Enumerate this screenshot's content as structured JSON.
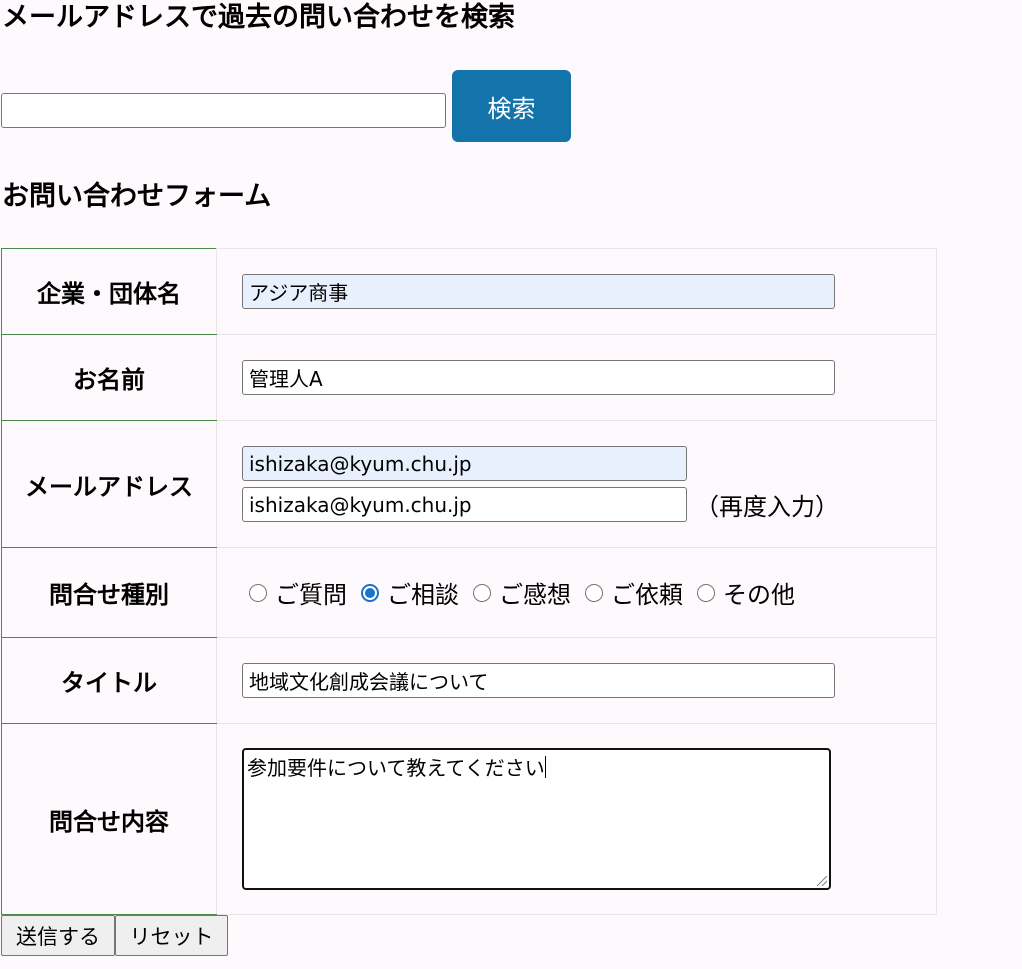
{
  "search": {
    "title": "メールアドレスで過去の問い合わせを検索",
    "input_value": "",
    "button_label": "検索"
  },
  "form": {
    "title": "お問い合わせフォーム",
    "company": {
      "label": "企業・団体名",
      "value": "アジア商事"
    },
    "name": {
      "label": "お名前",
      "value": "管理人A"
    },
    "email": {
      "label": "メールアドレス",
      "value": "ishizaka@kyum.chu.jp",
      "confirm_value": "ishizaka@kyum.chu.jp",
      "confirm_note": "（再度入力）"
    },
    "type": {
      "label": "問合せ種別",
      "options": [
        "ご質問",
        "ご相談",
        "ご感想",
        "ご依頼",
        "その他"
      ],
      "selected": "ご相談"
    },
    "subject": {
      "label": "タイトル",
      "value": "地域文化創成会議について"
    },
    "content": {
      "label": "問合せ内容",
      "value": "参加要件について教えてください"
    },
    "submit_label": "送信する",
    "reset_label": "リセット"
  },
  "colors": {
    "accent": "#1473aa",
    "radio_checked": "#1a73c8",
    "autofill": "#e8f0fe",
    "label_border": "#4b8a4b"
  }
}
